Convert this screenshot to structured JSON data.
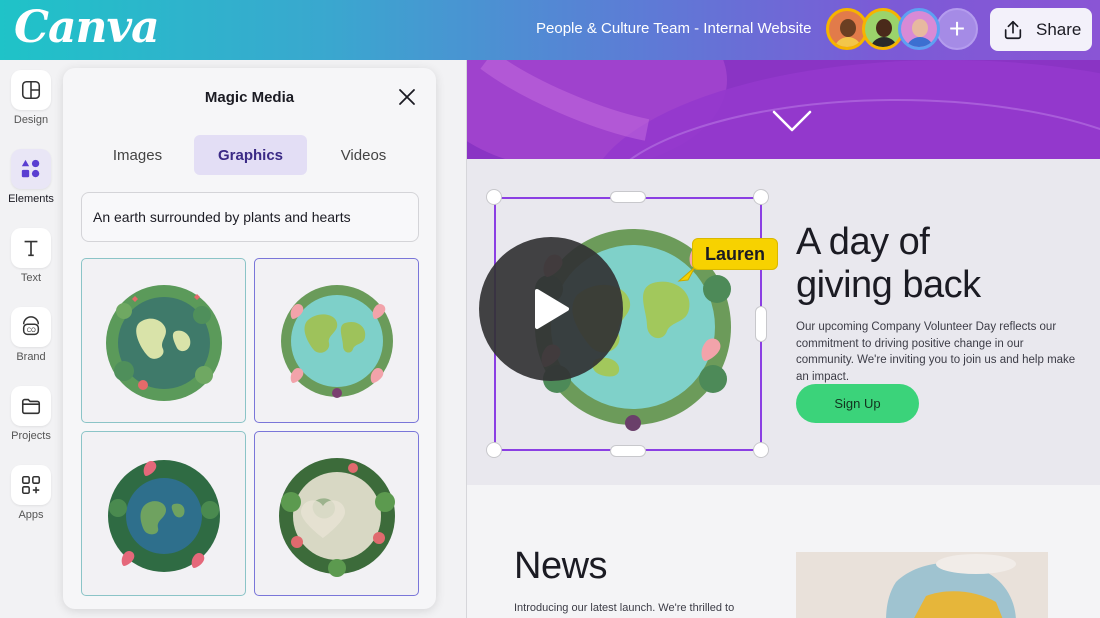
{
  "app": {
    "logo": "Canva",
    "doc_title": "People & Culture Team - Internal Website"
  },
  "header": {
    "share_label": "Share",
    "collaborator_count": 3
  },
  "rail": {
    "items": [
      {
        "label": "Design",
        "icon": "layout-icon"
      },
      {
        "label": "Elements",
        "icon": "shapes-icon"
      },
      {
        "label": "Text",
        "icon": "text-icon"
      },
      {
        "label": "Brand",
        "icon": "brand-icon"
      },
      {
        "label": "Projects",
        "icon": "folder-icon"
      },
      {
        "label": "Apps",
        "icon": "apps-icon"
      }
    ],
    "active": "Elements"
  },
  "panel": {
    "title": "Magic Media",
    "tabs": [
      {
        "label": "Images"
      },
      {
        "label": "Graphics"
      },
      {
        "label": "Videos"
      }
    ],
    "active_tab": "Graphics",
    "prompt_value": "An earth surrounded by plants and hearts",
    "results_count": 4
  },
  "canvas": {
    "hero": {
      "headline_line1": "A day of",
      "headline_line2": "giving back",
      "body": "Our upcoming Company Volunteer Day reflects our commitment to driving positive change in our community. We're inviting you to join us and help make an impact.",
      "cta": "Sign Up"
    },
    "cursor_tag": "Lauren",
    "news": {
      "title": "News",
      "body": "Introducing our latest launch. We're thrilled to"
    }
  },
  "colors": {
    "accent": "#8b3fe3",
    "cta": "#3bd37a",
    "hero_band": "#8d34c4",
    "tag": "#f7d200"
  }
}
